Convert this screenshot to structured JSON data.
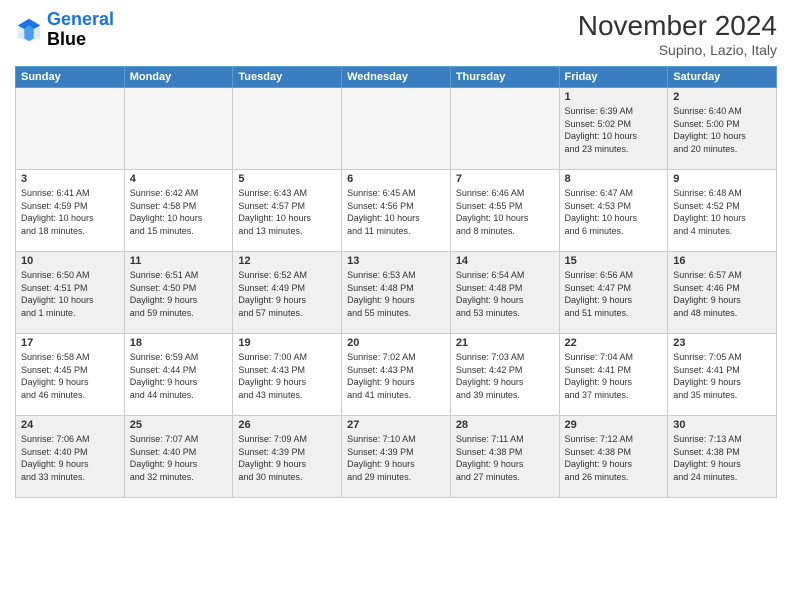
{
  "header": {
    "logo_line1": "General",
    "logo_line2": "Blue",
    "month_title": "November 2024",
    "location": "Supino, Lazio, Italy"
  },
  "weekdays": [
    "Sunday",
    "Monday",
    "Tuesday",
    "Wednesday",
    "Thursday",
    "Friday",
    "Saturday"
  ],
  "weeks": [
    [
      {
        "day": "",
        "info": ""
      },
      {
        "day": "",
        "info": ""
      },
      {
        "day": "",
        "info": ""
      },
      {
        "day": "",
        "info": ""
      },
      {
        "day": "",
        "info": ""
      },
      {
        "day": "1",
        "info": "Sunrise: 6:39 AM\nSunset: 5:02 PM\nDaylight: 10 hours\nand 23 minutes."
      },
      {
        "day": "2",
        "info": "Sunrise: 6:40 AM\nSunset: 5:00 PM\nDaylight: 10 hours\nand 20 minutes."
      }
    ],
    [
      {
        "day": "3",
        "info": "Sunrise: 6:41 AM\nSunset: 4:59 PM\nDaylight: 10 hours\nand 18 minutes."
      },
      {
        "day": "4",
        "info": "Sunrise: 6:42 AM\nSunset: 4:58 PM\nDaylight: 10 hours\nand 15 minutes."
      },
      {
        "day": "5",
        "info": "Sunrise: 6:43 AM\nSunset: 4:57 PM\nDaylight: 10 hours\nand 13 minutes."
      },
      {
        "day": "6",
        "info": "Sunrise: 6:45 AM\nSunset: 4:56 PM\nDaylight: 10 hours\nand 11 minutes."
      },
      {
        "day": "7",
        "info": "Sunrise: 6:46 AM\nSunset: 4:55 PM\nDaylight: 10 hours\nand 8 minutes."
      },
      {
        "day": "8",
        "info": "Sunrise: 6:47 AM\nSunset: 4:53 PM\nDaylight: 10 hours\nand 6 minutes."
      },
      {
        "day": "9",
        "info": "Sunrise: 6:48 AM\nSunset: 4:52 PM\nDaylight: 10 hours\nand 4 minutes."
      }
    ],
    [
      {
        "day": "10",
        "info": "Sunrise: 6:50 AM\nSunset: 4:51 PM\nDaylight: 10 hours\nand 1 minute."
      },
      {
        "day": "11",
        "info": "Sunrise: 6:51 AM\nSunset: 4:50 PM\nDaylight: 9 hours\nand 59 minutes."
      },
      {
        "day": "12",
        "info": "Sunrise: 6:52 AM\nSunset: 4:49 PM\nDaylight: 9 hours\nand 57 minutes."
      },
      {
        "day": "13",
        "info": "Sunrise: 6:53 AM\nSunset: 4:48 PM\nDaylight: 9 hours\nand 55 minutes."
      },
      {
        "day": "14",
        "info": "Sunrise: 6:54 AM\nSunset: 4:48 PM\nDaylight: 9 hours\nand 53 minutes."
      },
      {
        "day": "15",
        "info": "Sunrise: 6:56 AM\nSunset: 4:47 PM\nDaylight: 9 hours\nand 51 minutes."
      },
      {
        "day": "16",
        "info": "Sunrise: 6:57 AM\nSunset: 4:46 PM\nDaylight: 9 hours\nand 48 minutes."
      }
    ],
    [
      {
        "day": "17",
        "info": "Sunrise: 6:58 AM\nSunset: 4:45 PM\nDaylight: 9 hours\nand 46 minutes."
      },
      {
        "day": "18",
        "info": "Sunrise: 6:59 AM\nSunset: 4:44 PM\nDaylight: 9 hours\nand 44 minutes."
      },
      {
        "day": "19",
        "info": "Sunrise: 7:00 AM\nSunset: 4:43 PM\nDaylight: 9 hours\nand 43 minutes."
      },
      {
        "day": "20",
        "info": "Sunrise: 7:02 AM\nSunset: 4:43 PM\nDaylight: 9 hours\nand 41 minutes."
      },
      {
        "day": "21",
        "info": "Sunrise: 7:03 AM\nSunset: 4:42 PM\nDaylight: 9 hours\nand 39 minutes."
      },
      {
        "day": "22",
        "info": "Sunrise: 7:04 AM\nSunset: 4:41 PM\nDaylight: 9 hours\nand 37 minutes."
      },
      {
        "day": "23",
        "info": "Sunrise: 7:05 AM\nSunset: 4:41 PM\nDaylight: 9 hours\nand 35 minutes."
      }
    ],
    [
      {
        "day": "24",
        "info": "Sunrise: 7:06 AM\nSunset: 4:40 PM\nDaylight: 9 hours\nand 33 minutes."
      },
      {
        "day": "25",
        "info": "Sunrise: 7:07 AM\nSunset: 4:40 PM\nDaylight: 9 hours\nand 32 minutes."
      },
      {
        "day": "26",
        "info": "Sunrise: 7:09 AM\nSunset: 4:39 PM\nDaylight: 9 hours\nand 30 minutes."
      },
      {
        "day": "27",
        "info": "Sunrise: 7:10 AM\nSunset: 4:39 PM\nDaylight: 9 hours\nand 29 minutes."
      },
      {
        "day": "28",
        "info": "Sunrise: 7:11 AM\nSunset: 4:38 PM\nDaylight: 9 hours\nand 27 minutes."
      },
      {
        "day": "29",
        "info": "Sunrise: 7:12 AM\nSunset: 4:38 PM\nDaylight: 9 hours\nand 26 minutes."
      },
      {
        "day": "30",
        "info": "Sunrise: 7:13 AM\nSunset: 4:38 PM\nDaylight: 9 hours\nand 24 minutes."
      }
    ]
  ]
}
